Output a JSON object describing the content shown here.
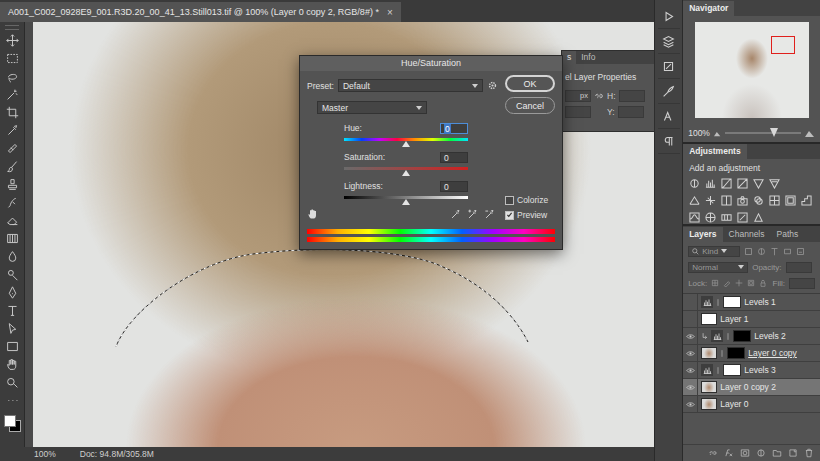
{
  "document": {
    "title": "A001_C002_0928E9_001.R3D.20_00_41_13.Still013.tif @ 100% (Layer 0 copy 2, RGB/8#) *",
    "close": "×"
  },
  "status_bar": {
    "zoom": "100%",
    "doc_info": "Doc: 94.8M/305.8M"
  },
  "properties_panel": {
    "tabs": [
      {
        "label": "s",
        "selected": true
      },
      {
        "label": "Info",
        "selected": false
      }
    ],
    "heading": "el Layer Properties",
    "unit": "px",
    "fields": [
      "H:",
      "Y:"
    ]
  },
  "dialog": {
    "title": "Hue/Saturation",
    "preset_label": "Preset:",
    "preset": "Default",
    "channel": "Master",
    "buttons": [
      {
        "label": "OK",
        "default": true
      },
      {
        "label": "Cancel",
        "default": false
      }
    ],
    "sliders": [
      {
        "label": "Hue:",
        "value": "0",
        "level": 0.5,
        "kind": "hue",
        "focused": true
      },
      {
        "label": "Saturation:",
        "value": "0",
        "level": 0.5,
        "kind": "saturation",
        "focused": false
      },
      {
        "label": "Lightness:",
        "value": "0",
        "level": 0.5,
        "kind": "lightness",
        "focused": false
      }
    ],
    "options": [
      {
        "label": "Colorize",
        "checked": false
      },
      {
        "label": "Preview",
        "checked": true
      }
    ]
  },
  "navigator": {
    "title": "Navigator",
    "zoom": "100%",
    "zoom_level": 0.65
  },
  "adjustments": {
    "title": "Adjustments",
    "subtitle": "Add an adjustment"
  },
  "layers_panel": {
    "tabs": [
      {
        "label": "Layers",
        "selected": true
      },
      {
        "label": "Channels",
        "selected": false
      },
      {
        "label": "Paths",
        "selected": false
      }
    ],
    "filter": "Kind",
    "blend_mode": "Normal",
    "opacity_label": "Opacity:",
    "lock_label": "Lock:",
    "fill_label": "Fill:",
    "layers": [
      {
        "name": "Levels 1",
        "kind": "adjustment",
        "visible": false,
        "selected": false,
        "clipped": false,
        "clip_base": false,
        "mask_inverted": false
      },
      {
        "name": "Layer 1",
        "kind": "blank",
        "visible": false,
        "selected": false,
        "clipped": false,
        "clip_base": false,
        "mask_inverted": false
      },
      {
        "name": "Levels 2",
        "kind": "adjustment",
        "visible": true,
        "selected": false,
        "clipped": true,
        "clip_base": false,
        "mask_inverted": true
      },
      {
        "name": "Layer 0 copy",
        "kind": "masked",
        "visible": true,
        "selected": false,
        "clipped": false,
        "clip_base": true,
        "mask_inverted": true
      },
      {
        "name": "Levels 3",
        "kind": "adjustment",
        "visible": true,
        "selected": false,
        "clipped": false,
        "clip_base": false,
        "mask_inverted": false
      },
      {
        "name": "Layer 0 copy 2",
        "kind": "photo",
        "visible": true,
        "selected": true,
        "clipped": false,
        "clip_base": false,
        "mask_inverted": false
      },
      {
        "name": "Layer 0",
        "kind": "photo",
        "visible": true,
        "selected": false,
        "clipped": false,
        "clip_base": false,
        "mask_inverted": false
      }
    ]
  }
}
